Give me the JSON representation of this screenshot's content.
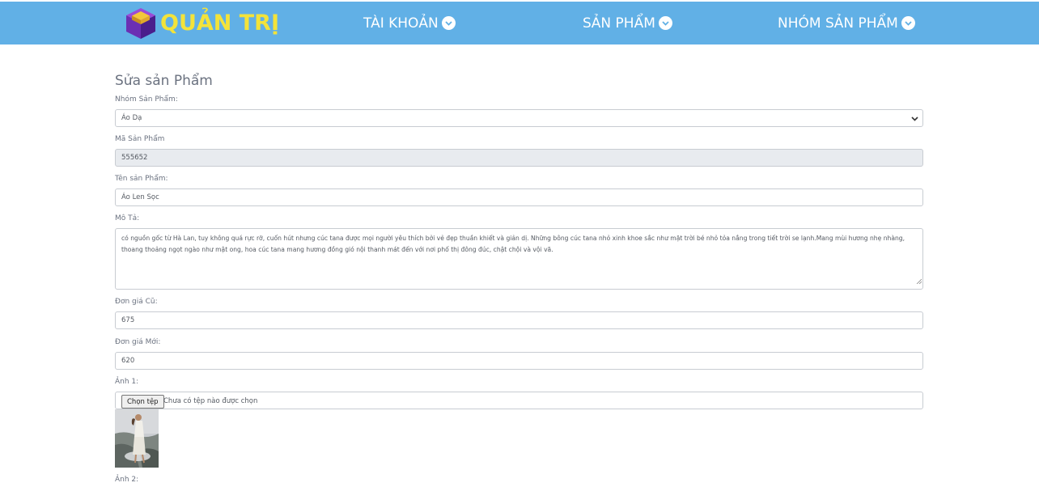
{
  "nav": {
    "logo_text": "QUẢN TRỊ",
    "items": [
      {
        "label": "TÀI KHOẢN"
      },
      {
        "label": "SẢN PHẨM"
      },
      {
        "label": "NHÓM SẢN PHẨM"
      }
    ],
    "background_color": "#61b0e6",
    "logo_text_color": "#f3e33a"
  },
  "form": {
    "title": "Sửa sản Phẩm",
    "group_label": "Nhóm Sản Phẩm:",
    "group_value": "Áo Dạ",
    "code_label": "Mã Sản Phẩm",
    "code_value": "555652",
    "name_label": "Tên sản Phẩm:",
    "name_value": "Áo Len Sọc",
    "desc_label": "Mô Tả:",
    "desc_value": "có nguồn gốc từ Hà Lan, tuy không quá rực rỡ, cuốn hút nhưng cúc tana được mọi người yêu thích bởi vẻ đẹp thuần khiết và giản dị. Những bông cúc tana nhỏ xinh khoe sắc như mặt trời bé nhỏ tỏa nắng trong tiết trời se lạnh.Mang mùi hương nhẹ nhàng, thoang thoảng ngọt ngào như mật ong, hoa cúc tana mang hương đồng gió nội thanh mát đến với nơi phố thị đông đúc, chật chội và vội vã.",
    "old_price_label": "Đơn giá Cũ:",
    "old_price_value": "675",
    "new_price_label": "Đơn giá Mới:",
    "new_price_value": "620",
    "image1_label": "Ảnh 1:",
    "file_button_label": "Chọn tệp",
    "file_status": "Chưa có tệp nào được chọn",
    "image2_label": "Ảnh 2:"
  }
}
